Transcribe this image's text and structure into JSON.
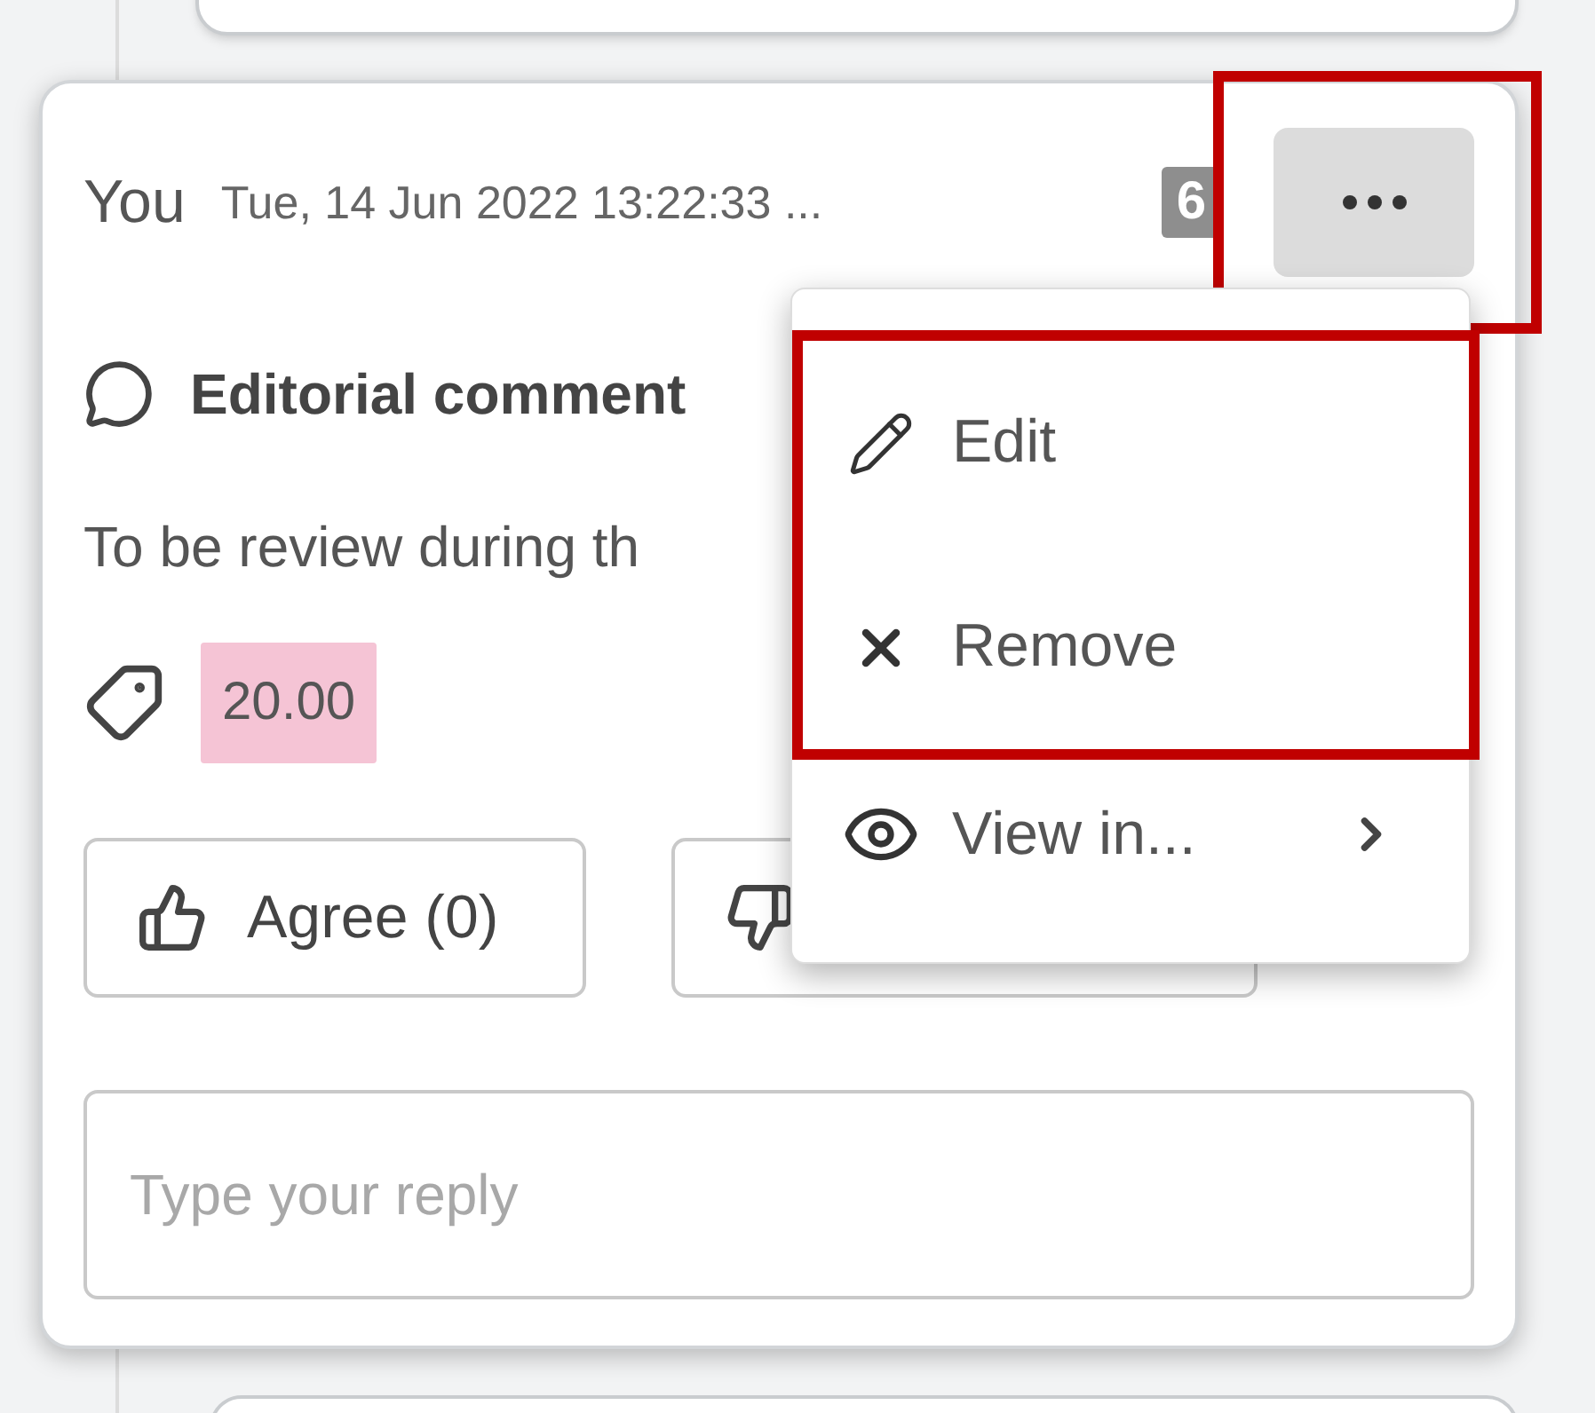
{
  "thread": {
    "author": "You",
    "timestamp": "Tue, 14 Jun 2022 13:22:33 ...",
    "badge": "6",
    "more_button": {
      "highlighted": true
    }
  },
  "comment": {
    "type_label": "Editorial comment",
    "body": "To be review during th",
    "tag": "20.00"
  },
  "reactions": [
    {
      "kind": "agree",
      "label": "Agree (0)"
    },
    {
      "kind": "disagree"
    }
  ],
  "reply": {
    "placeholder": "Type your reply"
  },
  "menu": {
    "open": true,
    "sections": [
      {
        "highlighted": true,
        "items": [
          {
            "kind": "edit",
            "label": "Edit"
          },
          {
            "kind": "remove",
            "label": "Remove"
          }
        ]
      },
      {
        "highlighted": false,
        "items": [
          {
            "kind": "view",
            "label": "View in...",
            "submenu": true
          }
        ]
      }
    ]
  }
}
